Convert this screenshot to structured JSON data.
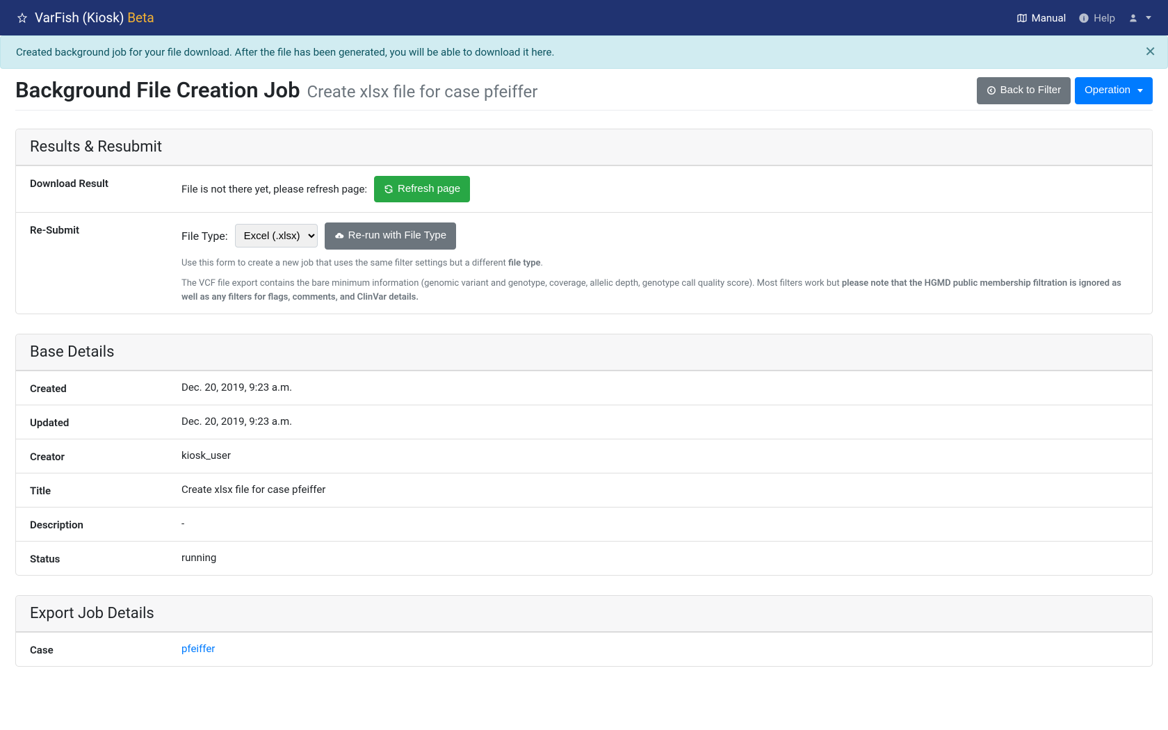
{
  "navbar": {
    "brand_main": "VarFish (Kiosk)",
    "brand_beta": "Beta",
    "manual": "Manual",
    "help": "Help"
  },
  "alert": {
    "message": "Created background job for your file download. After the file has been generated, you will be able to download it here."
  },
  "header": {
    "title": "Background File Creation Job",
    "subtitle": "Create xlsx file for case pfeiffer",
    "back_label": "Back to Filter",
    "operation_label": "Operation"
  },
  "results": {
    "card_title": "Results & Resubmit",
    "download_label": "Download Result",
    "download_msg": "File is not there yet, please refresh page:",
    "refresh_label": "Refresh page",
    "resubmit_label": "Re-Submit",
    "file_type_label": "File Type:",
    "file_type_selected": "Excel (.xlsx)",
    "rerun_label": "Re-run with File Type",
    "help1_a": "Use this form to create a new job that uses the same filter settings but a different ",
    "help1_b": "file type",
    "help1_c": ".",
    "help2_a": "The VCF file export contains the bare minimum information (genomic variant and genotype, coverage, allelic depth, genotype call quality score). Most filters work but ",
    "help2_b": "please note that the HGMD public membership filtration is ignored as well as any filters for flags, comments, and ClinVar details."
  },
  "base": {
    "card_title": "Base Details",
    "rows": [
      {
        "label": "Created",
        "value": "Dec. 20, 2019, 9:23 a.m."
      },
      {
        "label": "Updated",
        "value": "Dec. 20, 2019, 9:23 a.m."
      },
      {
        "label": "Creator",
        "value": "kiosk_user"
      },
      {
        "label": "Title",
        "value": "Create xlsx file for case pfeiffer"
      },
      {
        "label": "Description",
        "value": "-"
      },
      {
        "label": "Status",
        "value": "running"
      }
    ]
  },
  "export": {
    "card_title": "Export Job Details",
    "case_label": "Case",
    "case_value": "pfeiffer"
  }
}
